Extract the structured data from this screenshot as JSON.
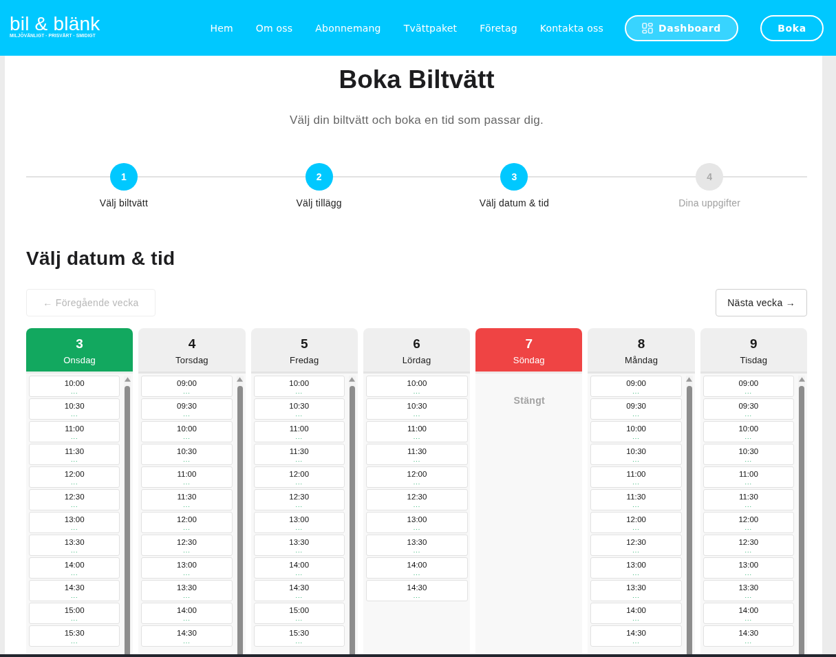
{
  "header": {
    "logo": {
      "name": "bil & blänk",
      "tagline": "MILJÖVÄNLIGT · PRISVÄRT · SMIDIGT"
    },
    "nav": [
      "Hem",
      "Om oss",
      "Abonnemang",
      "Tvättpaket",
      "Företag",
      "Kontakta oss"
    ],
    "dashboard_button": "Dashboard",
    "book_button": "Boka"
  },
  "page": {
    "title": "Boka Biltvätt",
    "subtitle": "Välj din biltvätt och boka en tid som passar dig."
  },
  "steps": [
    {
      "number": "1",
      "label": "Välj biltvätt",
      "active": true
    },
    {
      "number": "2",
      "label": "Välj tillägg",
      "active": true
    },
    {
      "number": "3",
      "label": "Välj datum & tid",
      "active": true
    },
    {
      "number": "4",
      "label": "Dina uppgifter",
      "active": false
    }
  ],
  "section_title": "Välj datum & tid",
  "week_nav": {
    "previous": {
      "label": "← Föregående vecka",
      "disabled": true
    },
    "next": {
      "label": "Nästa vecka →",
      "disabled": false
    }
  },
  "days": [
    {
      "date": "3",
      "weekday": "Onsdag",
      "selected": true,
      "closed": false,
      "slots": [
        {
          "time": "10:00",
          "info": "...",
          "selected": false
        },
        {
          "time": "10:30",
          "info": "...",
          "selected": false
        },
        {
          "time": "11:00",
          "info": "...",
          "selected": false
        },
        {
          "time": "11:30",
          "info": "...",
          "selected": false
        },
        {
          "time": "12:00",
          "info": "...",
          "selected": false
        },
        {
          "time": "12:30",
          "info": "...",
          "selected": false
        },
        {
          "time": "13:00",
          "info": "...",
          "selected": false
        },
        {
          "time": "13:30",
          "info": "...",
          "selected": false
        },
        {
          "time": "14:00",
          "info": "...",
          "selected": false
        },
        {
          "time": "14:30",
          "info": "...",
          "selected": false
        },
        {
          "time": "15:00",
          "info": "...",
          "selected": false
        },
        {
          "time": "15:30",
          "info": "...",
          "selected": false
        }
      ]
    },
    {
      "date": "4",
      "weekday": "Torsdag",
      "selected": false,
      "closed": false,
      "slots": [
        {
          "time": "09:00",
          "info": "...",
          "selected": false
        },
        {
          "time": "09:30",
          "info": "...",
          "selected": false
        },
        {
          "time": "10:00",
          "info": "...",
          "selected": false
        },
        {
          "time": "10:30",
          "info": "...",
          "selected": false
        },
        {
          "time": "11:00",
          "info": "...",
          "selected": false
        },
        {
          "time": "11:30",
          "info": "...",
          "selected": false
        },
        {
          "time": "12:00",
          "info": "...",
          "selected": false
        },
        {
          "time": "12:30",
          "info": "...",
          "selected": false
        },
        {
          "time": "13:00",
          "info": "...",
          "selected": false
        },
        {
          "time": "13:30",
          "info": "...",
          "selected": false
        },
        {
          "time": "14:00",
          "info": "...",
          "selected": false
        },
        {
          "time": "14:30",
          "info": "...",
          "selected": false
        }
      ]
    },
    {
      "date": "5",
      "weekday": "Fredag",
      "selected": false,
      "closed": false,
      "slots": [
        {
          "time": "10:00",
          "info": "...",
          "selected": false
        },
        {
          "time": "10:30",
          "info": "...",
          "selected": false
        },
        {
          "time": "11:00",
          "info": "...",
          "selected": false
        },
        {
          "time": "11:30",
          "info": "...",
          "selected": false
        },
        {
          "time": "12:00",
          "info": "...",
          "selected": false
        },
        {
          "time": "12:30",
          "info": "...",
          "selected": false
        },
        {
          "time": "13:00",
          "info": "...",
          "selected": false
        },
        {
          "time": "13:30",
          "info": "...",
          "selected": false
        },
        {
          "time": "14:00",
          "info": "...",
          "selected": false
        },
        {
          "time": "14:30",
          "info": "...",
          "selected": false
        },
        {
          "time": "15:00",
          "info": "...",
          "selected": false
        },
        {
          "time": "15:30",
          "info": "...",
          "selected": false
        }
      ]
    },
    {
      "date": "6",
      "weekday": "Lördag",
      "selected": false,
      "closed": false,
      "slots": [
        {
          "time": "10:00",
          "info": "...",
          "selected": false
        },
        {
          "time": "10:30",
          "info": "...",
          "selected": false
        },
        {
          "time": "11:00",
          "info": "...",
          "selected": false
        },
        {
          "time": "11:30",
          "info": "...",
          "selected": false
        },
        {
          "time": "12:00",
          "info": "...",
          "selected": false
        },
        {
          "time": "12:30",
          "info": "...",
          "selected": false
        },
        {
          "time": "13:00",
          "info": "...",
          "selected": false
        },
        {
          "time": "13:30",
          "info": "...",
          "selected": false
        },
        {
          "time": "14:00",
          "info": "...",
          "selected": false
        },
        {
          "time": "14:30",
          "info": "...",
          "selected": false
        }
      ]
    },
    {
      "date": "7",
      "weekday": "Söndag",
      "selected": false,
      "closed": true,
      "closed_text": "Stängt"
    },
    {
      "date": "8",
      "weekday": "Måndag",
      "selected": false,
      "closed": false,
      "slots": [
        {
          "time": "09:00",
          "info": "...",
          "selected": false
        },
        {
          "time": "09:30",
          "info": "...",
          "selected": false
        },
        {
          "time": "10:00",
          "info": "...",
          "selected": false
        },
        {
          "time": "10:30",
          "info": "...",
          "selected": false
        },
        {
          "time": "11:00",
          "info": "...",
          "selected": false
        },
        {
          "time": "11:30",
          "info": "...",
          "selected": false
        },
        {
          "time": "12:00",
          "info": "...",
          "selected": false
        },
        {
          "time": "12:30",
          "info": "...",
          "selected": false
        },
        {
          "time": "13:00",
          "info": "...",
          "selected": false
        },
        {
          "time": "13:30",
          "info": "...",
          "selected": false
        },
        {
          "time": "14:00",
          "info": "...",
          "selected": false
        },
        {
          "time": "14:30",
          "info": "...",
          "selected": false
        }
      ]
    },
    {
      "date": "9",
      "weekday": "Tisdag",
      "selected": false,
      "closed": false,
      "slots": [
        {
          "time": "09:00",
          "info": "...",
          "selected": false
        },
        {
          "time": "09:30",
          "info": "...",
          "selected": false
        },
        {
          "time": "10:00",
          "info": "...",
          "selected": false
        },
        {
          "time": "10:30",
          "info": "...",
          "selected": false
        },
        {
          "time": "11:00",
          "info": "...",
          "selected": false
        },
        {
          "time": "11:30",
          "info": "...",
          "selected": false
        },
        {
          "time": "12:00",
          "info": "...",
          "selected": false
        },
        {
          "time": "12:30",
          "info": "...",
          "selected": false
        },
        {
          "time": "13:00",
          "info": "...",
          "selected": false
        },
        {
          "time": "13:30",
          "info": "...",
          "selected": false
        },
        {
          "time": "14:00",
          "info": "...",
          "selected": false
        },
        {
          "time": "14:30",
          "info": "...",
          "selected": false
        }
      ]
    }
  ]
}
